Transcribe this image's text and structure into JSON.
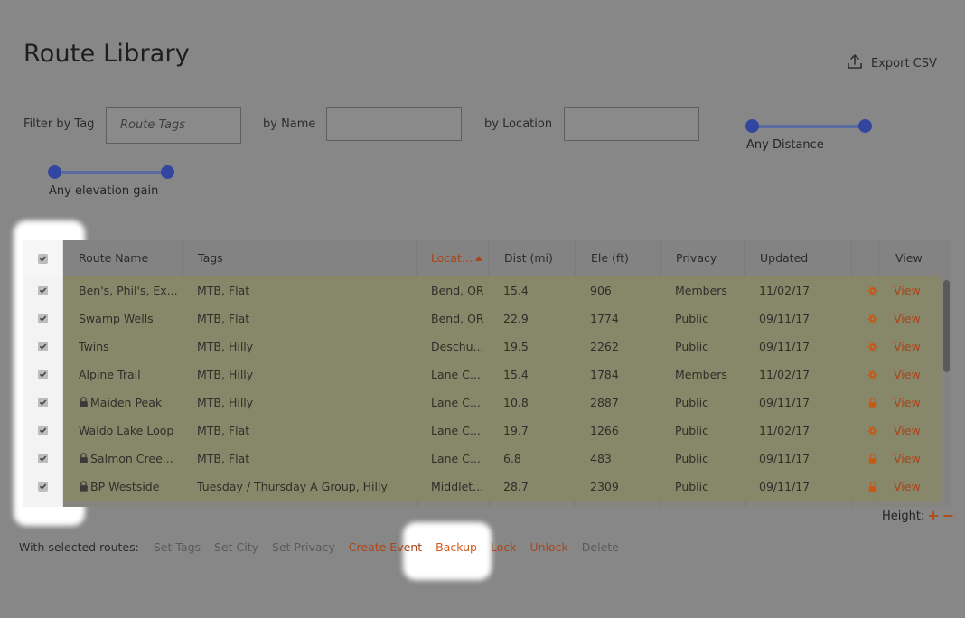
{
  "header": {
    "title": "Route Library",
    "export_label": "Export CSV"
  },
  "filters": {
    "tag_label": "Filter by Tag",
    "tag_placeholder": "Route Tags",
    "name_label": "by Name",
    "name_value": "",
    "location_label": "by Location",
    "location_value": "",
    "distance_label": "Any Distance",
    "elevation_label": "Any elevation gain"
  },
  "table": {
    "columns": [
      "Route Name",
      "Tags",
      "Locat...",
      "Dist (mi)",
      "Ele (ft)",
      "Privacy",
      "Updated",
      "View"
    ],
    "sorted_column": "Locat...",
    "rows": [
      {
        "name": "Ben's, Phil's, Ex...",
        "locked": false,
        "tags": "MTB, Flat",
        "location": "Bend, OR",
        "dist": "15.4",
        "ele": "906",
        "privacy": "Members",
        "updated": "11/02/17",
        "icon": "gear-icon",
        "view": "View"
      },
      {
        "name": "Swamp Wells",
        "locked": false,
        "tags": "MTB, Flat",
        "location": "Bend, OR",
        "dist": "22.9",
        "ele": "1774",
        "privacy": "Public",
        "updated": "09/11/17",
        "icon": "gear-icon",
        "view": "View"
      },
      {
        "name": "Twins",
        "locked": false,
        "tags": "MTB, Hilly",
        "location": "Deschu...",
        "dist": "19.5",
        "ele": "2262",
        "privacy": "Public",
        "updated": "09/11/17",
        "icon": "gear-icon",
        "view": "View"
      },
      {
        "name": "Alpine Trail",
        "locked": false,
        "tags": "MTB, Hilly",
        "location": "Lane C...",
        "dist": "15.4",
        "ele": "1784",
        "privacy": "Members",
        "updated": "11/02/17",
        "icon": "gear-icon",
        "view": "View"
      },
      {
        "name": "Maiden Peak",
        "locked": true,
        "tags": "MTB, Hilly",
        "location": "Lane C...",
        "dist": "10.8",
        "ele": "2887",
        "privacy": "Public",
        "updated": "09/11/17",
        "icon": "lock-icon",
        "view": "View"
      },
      {
        "name": "Waldo Lake Loop",
        "locked": false,
        "tags": "MTB, Flat",
        "location": "Lane C...",
        "dist": "19.7",
        "ele": "1266",
        "privacy": "Public",
        "updated": "11/02/17",
        "icon": "gear-icon",
        "view": "View"
      },
      {
        "name": "Salmon Cree...",
        "locked": true,
        "tags": "MTB, Flat",
        "location": "Lane C...",
        "dist": "6.8",
        "ele": "483",
        "privacy": "Public",
        "updated": "09/11/17",
        "icon": "lock-icon",
        "view": "View"
      },
      {
        "name": "BP Westside",
        "locked": true,
        "tags": "Tuesday / Thursday A Group, Hilly",
        "location": "Middlet...",
        "dist": "28.7",
        "ele": "2309",
        "privacy": "Public",
        "updated": "09/11/17",
        "icon": "lock-icon",
        "view": "View"
      }
    ]
  },
  "height_control": {
    "label": "Height:",
    "plus": "+",
    "minus": "−"
  },
  "actions": {
    "label": "With selected routes:",
    "items": [
      {
        "label": "Set Tags",
        "enabled": false
      },
      {
        "label": "Set City",
        "enabled": false
      },
      {
        "label": "Set Privacy",
        "enabled": false
      },
      {
        "label": "Create Event",
        "enabled": true
      },
      {
        "label": "Backup",
        "enabled": true
      },
      {
        "label": "Lock",
        "enabled": true
      },
      {
        "label": "Unlock",
        "enabled": true
      },
      {
        "label": "Delete",
        "enabled": false
      }
    ]
  },
  "colors": {
    "accent": "#a8451a",
    "slider": "#3246a0"
  }
}
